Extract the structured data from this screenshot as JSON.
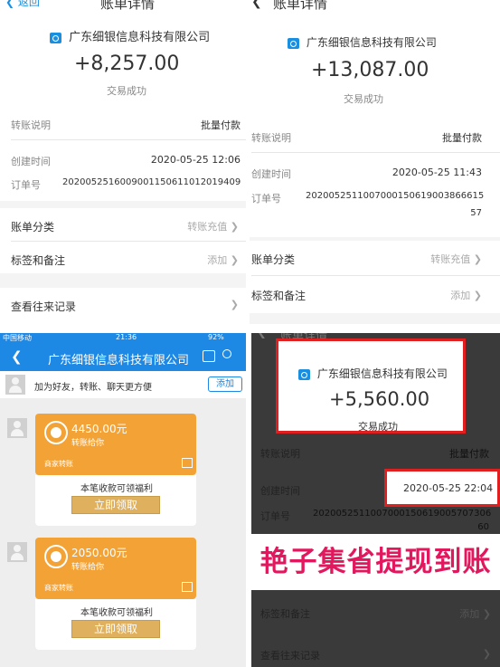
{
  "p1": {
    "back": "返回",
    "title": "账单详情",
    "company": "广东细银信息科技有限公司",
    "amount": "+8,257.00",
    "status": "交易成功",
    "rows": [
      {
        "label": "转账说明",
        "value": "批量付款"
      },
      {
        "label": "创建时间",
        "value": "2020-05-25 12:06"
      },
      {
        "label": "订单号",
        "value": "2020052516009001150611012019409"
      }
    ],
    "bill_category": {
      "label": "账单分类",
      "value": "转账充值"
    },
    "tags_notes": {
      "label": "标签和备注",
      "value": "添加"
    },
    "history": {
      "label": "查看往来记录"
    }
  },
  "p2": {
    "title": "账单详情",
    "company": "广东细银信息科技有限公司",
    "amount": "+13,087.00",
    "status": "交易成功",
    "rows": [
      {
        "label": "转账说明",
        "value": "批量付款"
      },
      {
        "label": "创建时间",
        "value": "2020-05-25 11:43"
      },
      {
        "label": "订单号",
        "value": "2020052511007000150619003866615",
        "value2": "57"
      }
    ],
    "bill_category": {
      "label": "账单分类",
      "value": "转账充值"
    },
    "tags_notes": {
      "label": "标签和备注",
      "value": "添加"
    }
  },
  "p3": {
    "status_bar": {
      "carrier": "中国移动",
      "time": "21:36",
      "battery": "92%"
    },
    "title": "广东细银信息科技有限公司",
    "add_friend_text": "加为好友，转账、聊天更方便",
    "add_button": "添加",
    "messages": [
      {
        "amount": "4450.00元",
        "subtitle": "转账给你",
        "footer": "商家转账",
        "promo": "本笔收款可领福利",
        "button": "立即领取"
      },
      {
        "amount": "2050.00元",
        "subtitle": "转账给你",
        "footer": "商家转账",
        "promo": "本笔收款可领福利",
        "button": "立即领取"
      }
    ]
  },
  "p4": {
    "title": "账单详情",
    "company": "广东细银信息科技有限公司",
    "amount": "+5,560.00",
    "status": "交易成功",
    "rows": [
      {
        "label": "转账说明",
        "value": "批量付款"
      },
      {
        "label": "创建时间",
        "value": "2020-05-25 22:04"
      },
      {
        "label": "订单号",
        "value": "2020052511007000150619005707306",
        "value2": "60"
      }
    ],
    "banner": "艳子集省提现到账",
    "tags_notes": {
      "label": "标签和备注",
      "value": "添加"
    },
    "history": {
      "label": "查看往来记录"
    }
  },
  "colors": {
    "blue": "#1e88e5",
    "orange": "#f3a236",
    "red": "#e02020",
    "banner_text": "#e2185f"
  }
}
